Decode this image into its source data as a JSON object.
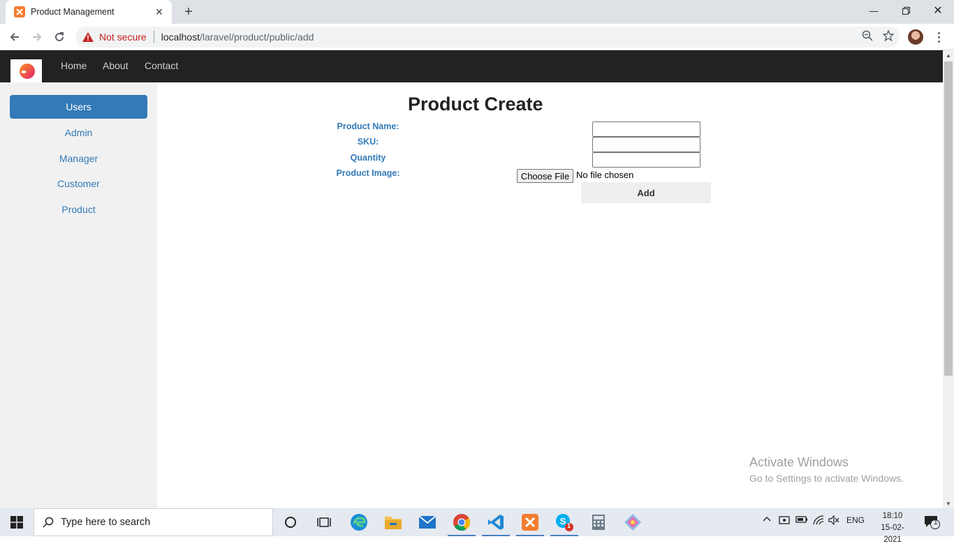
{
  "browser": {
    "tab_title": "Product Management",
    "security_label": "Not secure",
    "url_host": "localhost",
    "url_path": "/laravel/product/public/add"
  },
  "site_nav": {
    "links": [
      "Home",
      "About",
      "Contact"
    ]
  },
  "sidebar": {
    "items": [
      {
        "label": "Users",
        "active": true
      },
      {
        "label": "Admin",
        "active": false
      },
      {
        "label": "Manager",
        "active": false
      },
      {
        "label": "Customer",
        "active": false
      },
      {
        "label": "Product",
        "active": false
      }
    ]
  },
  "form": {
    "title": "Product Create",
    "fields": [
      {
        "label": "Product Name:",
        "value": ""
      },
      {
        "label": "SKU:",
        "value": ""
      },
      {
        "label": "Quantity",
        "value": ""
      }
    ],
    "image_label": "Product Image:",
    "file_button": "Choose File",
    "file_status": "No file chosen",
    "submit_label": "Add"
  },
  "watermark": {
    "title": "Activate Windows",
    "subtitle": "Go to Settings to activate Windows."
  },
  "taskbar": {
    "search_placeholder": "Type here to search",
    "language": "ENG",
    "time": "18:10",
    "date": "15-02-2021",
    "skype_badge": "1",
    "notification_count": "1"
  },
  "colors": {
    "accent": "#337ab7",
    "navbar": "#222222",
    "sidebar_bg": "#f1f1f1"
  }
}
